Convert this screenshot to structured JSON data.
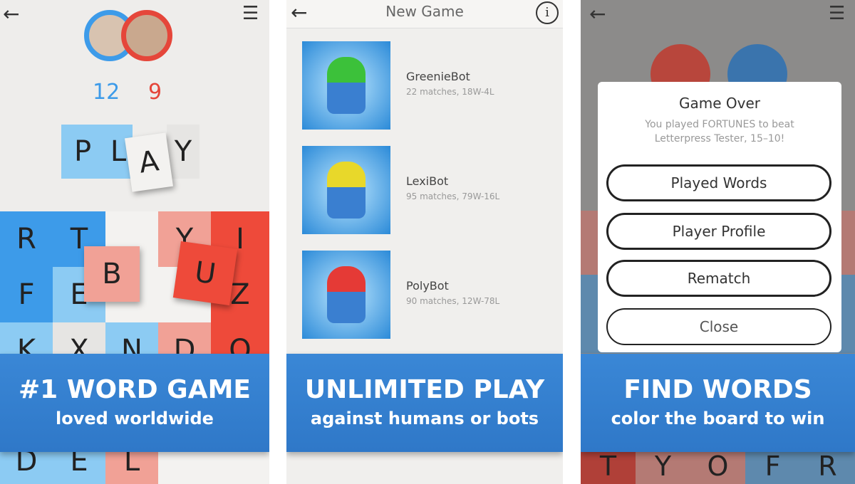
{
  "panel1": {
    "scores": {
      "blue": "12",
      "red": "9"
    },
    "play_word": [
      "P",
      "L",
      "A",
      "Y"
    ],
    "board": [
      {
        "l": "R",
        "c": "db"
      },
      {
        "l": "T",
        "c": "db"
      },
      {
        "l": "",
        "c": "wh"
      },
      {
        "l": "Y",
        "c": "lr"
      },
      {
        "l": "I",
        "c": "rd"
      },
      {
        "l": "F",
        "c": "db"
      },
      {
        "l": "E",
        "c": "lb"
      },
      {
        "l": "",
        "c": "wh"
      },
      {
        "l": "",
        "c": "wh"
      },
      {
        "l": "Z",
        "c": "rd"
      },
      {
        "l": "K",
        "c": "lb"
      },
      {
        "l": "X",
        "c": "gr"
      },
      {
        "l": "N",
        "c": "lb"
      },
      {
        "l": "D",
        "c": "lr"
      },
      {
        "l": "O",
        "c": "rd"
      },
      {
        "l": "",
        "c": "lb"
      },
      {
        "l": "",
        "c": "wh"
      },
      {
        "l": "",
        "c": "lb"
      },
      {
        "l": "",
        "c": "lr"
      },
      {
        "l": "",
        "c": "rd"
      },
      {
        "l": "D",
        "c": "lb"
      },
      {
        "l": "E",
        "c": "lb"
      },
      {
        "l": "L",
        "c": "lr"
      },
      {
        "l": "",
        "c": "wh"
      },
      {
        "l": "",
        "c": "wh"
      }
    ],
    "floating": {
      "b": "B",
      "u": "U"
    },
    "banner": {
      "headline": "#1 WORD GAME",
      "sub": "loved worldwide"
    }
  },
  "panel2": {
    "title": "New Game",
    "info_icon": "i",
    "bots": [
      {
        "name": "GreenieBot",
        "stats": "22 matches, 18W-4L",
        "color": "#3cc13a"
      },
      {
        "name": "LexiBot",
        "stats": "95 matches, 79W-16L",
        "color": "#e8d82a"
      },
      {
        "name": "PolyBot",
        "stats": "90 matches, 12W-78L",
        "color": "#e53a36"
      }
    ],
    "banner": {
      "headline": "UNLIMITED PLAY",
      "sub": "against humans or bots"
    }
  },
  "panel3": {
    "dialog": {
      "title": "Game Over",
      "message": "You played FORTUNES to beat Letterpress Tester, 15–10!",
      "buttons": [
        "Played Words",
        "Player Profile",
        "Rematch",
        "Close"
      ]
    },
    "bottom_row": [
      "T",
      "Y",
      "O",
      "F",
      "R"
    ],
    "banner": {
      "headline": "FIND WORDS",
      "sub": "color the board to win"
    }
  },
  "colors": {
    "blue": "#3d9be9",
    "light_blue": "#8ccbf3",
    "red": "#ee4a3a",
    "light_red": "#f1a196",
    "banner": "#3080cc"
  }
}
